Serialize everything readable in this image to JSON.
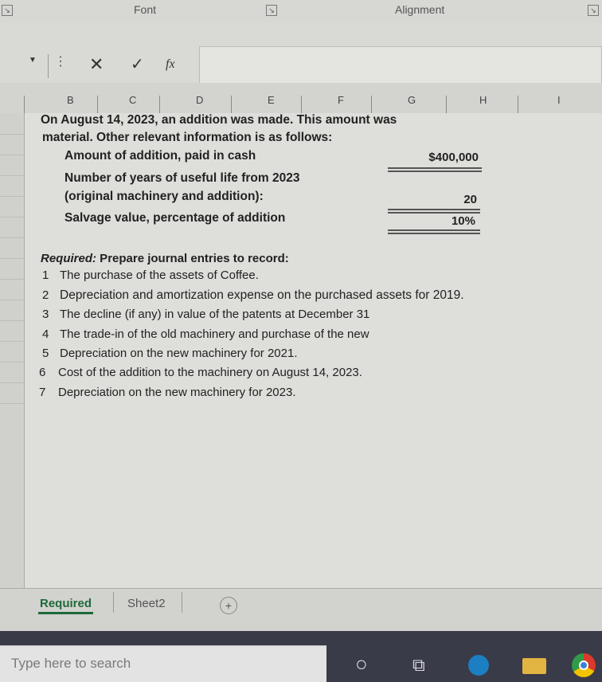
{
  "ribbon": {
    "font_label": "Font",
    "alignment_label": "Alignment",
    "launcher_glyph": "↘"
  },
  "formula_bar": {
    "cancel_glyph": "✕",
    "enter_glyph": "✓",
    "function_glyph": "fx",
    "value": ""
  },
  "columns": [
    "B",
    "C",
    "D",
    "E",
    "F",
    "G",
    "H",
    "I"
  ],
  "content": {
    "intro_line1": "On August 14, 2023, an addition was made. This amount was",
    "intro_line2": "material. Other relevant information is as follows:",
    "amount_label": "Amount of addition, paid in cash",
    "amount_value": "$400,000",
    "years_label1": "Number of years of useful life from 2023",
    "years_label2": "(original machinery and addition):",
    "years_value": "20",
    "salvage_label": "Salvage value, percentage of addition",
    "salvage_value": "10%",
    "required_heading": "Required:",
    "required_text": " Prepare journal entries to record:",
    "items": [
      {
        "num": "1",
        "text": "The purchase of the assets of Coffee."
      },
      {
        "num": "2",
        "text": "Depreciation and amortization expense on the purchased assets for 2019."
      },
      {
        "num": "3",
        "text": "The decline (if any) in value of the patents at December 31"
      },
      {
        "num": "4",
        "text": "The trade-in of the old machinery and purchase of the new"
      },
      {
        "num": "5",
        "text": "Depreciation on the new machinery for 2021."
      },
      {
        "num": "6",
        "text": "Cost of the addition to the machinery on August 14, 2023."
      },
      {
        "num": "7",
        "text": "Depreciation on the new machinery for 2023."
      }
    ]
  },
  "tabs": [
    {
      "label": "Required",
      "active": true
    },
    {
      "label": "Sheet2",
      "active": false
    }
  ],
  "add_sheet_glyph": "+",
  "taskbar": {
    "search_placeholder": "Type here to search"
  }
}
